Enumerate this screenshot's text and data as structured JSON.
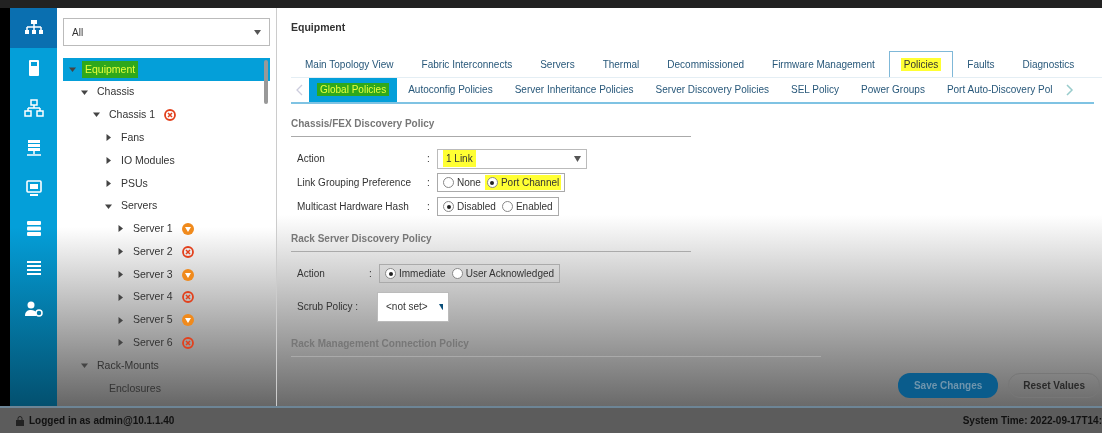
{
  "nav_rail": {
    "items": [
      {
        "selected": true
      },
      {
        "selected": false
      },
      {
        "selected": false
      },
      {
        "selected": false
      },
      {
        "selected": false
      },
      {
        "selected": false
      },
      {
        "selected": false
      },
      {
        "selected": false
      }
    ]
  },
  "filter": {
    "value": "All"
  },
  "tree": [
    {
      "label": "Equipment",
      "expanded": true,
      "selected": true,
      "color": "#2fa81c",
      "children": [
        {
          "label": "Chassis",
          "expanded": true,
          "selected": false,
          "children": [
            {
              "label": "Chassis 1",
              "expanded": true,
              "selected": false,
              "kind": "critical",
              "children": [
                {
                  "label": "Fans",
                  "expanded": false,
                  "selected": false
                },
                {
                  "label": "IO Modules",
                  "expanded": false,
                  "selected": false
                },
                {
                  "label": "PSUs",
                  "expanded": false,
                  "selected": false
                },
                {
                  "label": "Servers",
                  "expanded": true,
                  "selected": false,
                  "children": [
                    {
                      "label": "Server 1",
                      "expanded": false,
                      "selected": false,
                      "kind": "major"
                    },
                    {
                      "label": "Server 2",
                      "expanded": false,
                      "selected": false,
                      "kind": "critical"
                    },
                    {
                      "label": "Server 3",
                      "expanded": false,
                      "selected": false,
                      "kind": "major"
                    },
                    {
                      "label": "Server 4",
                      "expanded": false,
                      "selected": false,
                      "kind": "critical"
                    },
                    {
                      "label": "Server 5",
                      "expanded": false,
                      "selected": false,
                      "kind": "major"
                    },
                    {
                      "label": "Server 6",
                      "expanded": false,
                      "selected": false,
                      "kind": "critical"
                    }
                  ]
                }
              ]
            }
          ]
        },
        {
          "label": "Rack-Mounts",
          "expanded": true,
          "selected": false,
          "children": [
            {
              "label": "Enclosures",
              "selected": false
            }
          ]
        }
      ]
    }
  ],
  "main": {
    "title": "Equipment",
    "tabs": [
      {
        "label": "Main Topology View",
        "selected": false
      },
      {
        "label": "Fabric Interconnects",
        "selected": false
      },
      {
        "label": "Servers",
        "selected": false
      },
      {
        "label": "Thermal",
        "selected": false
      },
      {
        "label": "Decommissioned",
        "selected": false
      },
      {
        "label": "Firmware Management",
        "selected": false
      },
      {
        "label": "Policies",
        "selected": true,
        "color": "#ffff33"
      },
      {
        "label": "Faults",
        "selected": false
      },
      {
        "label": "Diagnostics",
        "selected": false
      }
    ],
    "subtabs": [
      {
        "label": "Global Policies",
        "selected": true,
        "color": "#2fa81c"
      },
      {
        "label": "Autoconfig Policies",
        "selected": false
      },
      {
        "label": "Server Inheritance Policies",
        "selected": false
      },
      {
        "label": "Server Discovery Policies",
        "selected": false
      },
      {
        "label": "SEL Policy",
        "selected": false
      },
      {
        "label": "Power Groups",
        "selected": false
      },
      {
        "label": "Port Auto-Discovery Pol",
        "selected": false
      }
    ],
    "sections": [
      {
        "title": "Chassis/FEX Discovery Policy",
        "fields": [
          {
            "label": "Action",
            "separator": ":",
            "kind": "select",
            "value": "1 Link",
            "color": "#ffff33"
          },
          {
            "label": "Link Grouping Preference",
            "separator": ":",
            "kind": "radio",
            "options": [
              {
                "label": "None",
                "selected": false
              },
              {
                "label": "Port Channel",
                "selected": true,
                "color": "#ffff33"
              }
            ]
          },
          {
            "label": "Multicast Hardware Hash",
            "separator": ":",
            "kind": "radio",
            "options": [
              {
                "label": "Disabled",
                "selected": true
              },
              {
                "label": "Enabled",
                "selected": false
              }
            ]
          }
        ]
      },
      {
        "title": "Rack Server Discovery Policy",
        "fields": [
          {
            "label": "Action",
            "separator": ":",
            "kind": "radio",
            "options": [
              {
                "label": "Immediate",
                "selected": true
              },
              {
                "label": "User Acknowledged",
                "selected": false
              }
            ]
          },
          {
            "label": "Scrub Policy :",
            "kind": "select",
            "value": "<not set>"
          }
        ]
      },
      {
        "title": "Rack Management Connection Policy"
      }
    ],
    "buttons": [
      {
        "label": "Save Changes",
        "kind": "primary"
      },
      {
        "label": "Reset Values",
        "kind": "secondary"
      }
    ]
  },
  "status_bar": {
    "user": "Logged in as admin@10.1.1.40",
    "time": "System Time: 2022-09-17T14:"
  }
}
